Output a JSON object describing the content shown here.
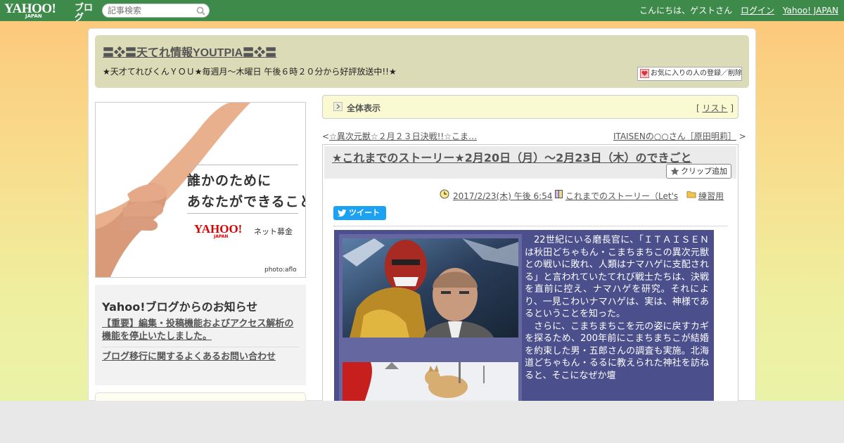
{
  "topbar": {
    "logo_main": "YAHOO!",
    "logo_sub": "JAPAN",
    "logo_blog": "ブログ",
    "search_placeholder": "記事検索",
    "greeting": "こんにちは、ゲストさん",
    "login": "ログイン",
    "yahoo_japan": "Yahoo! JAPAN"
  },
  "header": {
    "title": "〓❖〓天てれ情報YOUTPIA〓❖〓",
    "description": "★天才てれびくんＹＯＵ★毎週月～木曜日 午後６時２０分から好評放送中!!★",
    "fav_button": "お気に入りの人の登録／削除"
  },
  "ad": {
    "line1": "誰かのために",
    "line2": "あなたができること",
    "brand": "YAHOO!",
    "brand_sub": "JAPAN",
    "service": "ネット募金",
    "credit": "photo:aflo"
  },
  "notice": {
    "title": "Yahoo!ブログからのお知らせ",
    "items": [
      "【重要】編集・投稿機能およびアクセス解析の機能を停止いたしました。",
      "ブログ移行に関するよくあるお問い合わせ"
    ]
  },
  "allview": {
    "label": "全体表示",
    "list_open": "[ ",
    "list_link": "リスト",
    "list_close": " ]"
  },
  "nav": {
    "prev_prefix": "<",
    "prev": "☆異次元獣☆２月２３日決戦!!☆こま…",
    "next": "ITAISENの○○さん［原田明莉］",
    "next_suffix": " >"
  },
  "article": {
    "title": "★これまでのストーリー★2月20日（月）～2月23日（木）のできごと",
    "clip_button": "クリップ追加",
    "date": "2017/2/23(木) 午後 6:54",
    "category": "これまでのストーリー（Let's",
    "folder": "練習用",
    "tweet": "ツイート",
    "paragraphs": [
      "22世紀にいる磨長官に、「ＩＴＡＩＳＥＮは秋田どちゃもん・こまちまちこの異次元獣との戦いに敗れ、人類はナマハゲに支配される」と言われていたてれび戦士たちは、決戦を直前に控え、ナマハゲを研究。それにより、一見こわいナマハゲは、実は、神様であるということを知った。",
      "さらに、こまちまちこを元の姿に戻すカギを探るため、200年前にこまちまちこが結婚を約束した男・五郎さんの調査も実施。北海道どちゃもん・るるに教えられた神社を訪ねると、そこになぜか壇"
    ]
  },
  "colors": {
    "topbar": "#3d8a4a",
    "header_bg": "#dbdbb7",
    "content_bg": "#4b4f8c",
    "tweet": "#1da1f2"
  }
}
